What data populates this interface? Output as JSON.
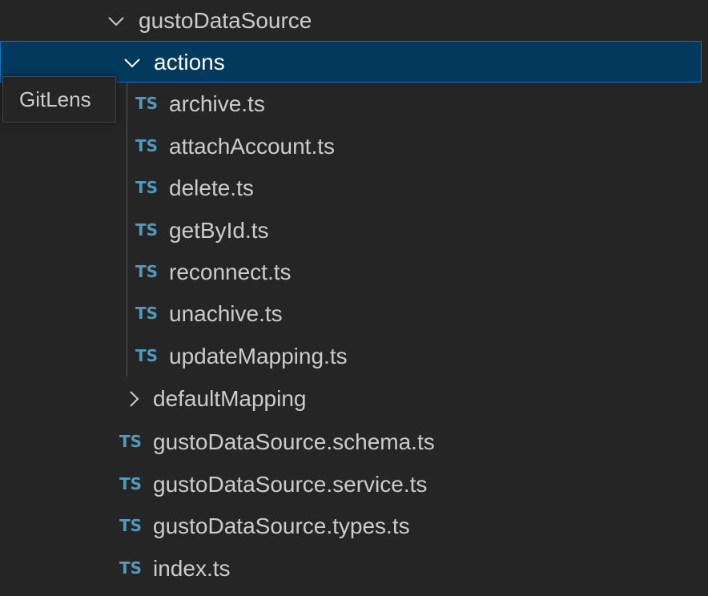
{
  "explorer": {
    "root_folder": {
      "label": "gustoDataSource",
      "state": "expanded"
    },
    "actions_folder": {
      "label": "actions",
      "state": "expanded",
      "selected": true
    },
    "action_files": [
      {
        "icon": "TS",
        "label": "archive.ts"
      },
      {
        "icon": "TS",
        "label": "attachAccount.ts"
      },
      {
        "icon": "TS",
        "label": "delete.ts"
      },
      {
        "icon": "TS",
        "label": "getById.ts"
      },
      {
        "icon": "TS",
        "label": "reconnect.ts"
      },
      {
        "icon": "TS",
        "label": "unachive.ts"
      },
      {
        "icon": "TS",
        "label": "updateMapping.ts"
      }
    ],
    "default_mapping_folder": {
      "label": "defaultMapping",
      "state": "collapsed"
    },
    "root_files": [
      {
        "icon": "TS",
        "label": "gustoDataSource.schema.ts"
      },
      {
        "icon": "TS",
        "label": "gustoDataSource.service.ts"
      },
      {
        "icon": "TS",
        "label": "gustoDataSource.types.ts"
      },
      {
        "icon": "TS",
        "label": "index.ts"
      }
    ]
  },
  "tooltip": {
    "text": "GitLens"
  },
  "colors": {
    "background": "#252526",
    "selection_background": "#04395e",
    "selection_border": "#0e70c0",
    "ts_icon": "#519aba",
    "text": "#cccccc"
  },
  "icons": {
    "expanded": "chevron-down-icon",
    "collapsed": "chevron-right-icon",
    "file": "typescript-file-icon"
  }
}
